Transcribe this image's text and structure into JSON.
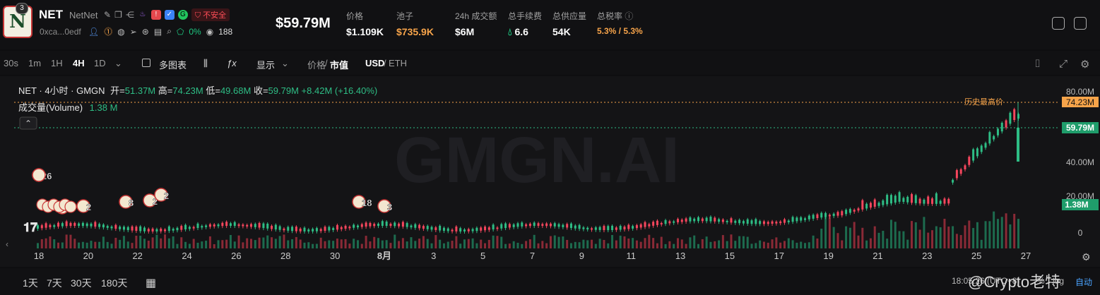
{
  "token": {
    "badge": "3",
    "logo_letter": "N",
    "symbol": "NET",
    "name": "NetNet",
    "unsafe_label": "不安全",
    "address": "0xca...0edf",
    "holders_change": "0%",
    "watchers": "188"
  },
  "market": {
    "market_cap": "$59.79M",
    "stats": [
      {
        "label": "价格",
        "value": "$1.109K"
      },
      {
        "label": "池子",
        "value": "$735.9K"
      },
      {
        "label": "24h 成交额",
        "value": "$6M"
      },
      {
        "label": "总手续费",
        "value": "6.6"
      },
      {
        "label": "总供应量",
        "value": "54K"
      },
      {
        "label": "总税率",
        "value": "5.3% / 5.3%"
      }
    ]
  },
  "toolbar": {
    "intervals": [
      "30s",
      "1m",
      "1H",
      "4H",
      "1D"
    ],
    "active_interval": "4H",
    "multi_chart": "多图表",
    "display": "显示",
    "price_label": "价格",
    "mcap_label": "市值",
    "usd_label": "USD",
    "eth_label": "ETH"
  },
  "chart": {
    "legend_title": "NET · 4小时 · GMGN",
    "open_label": "开=",
    "open_value": "51.37M",
    "high_label": "高=",
    "high_value": "74.23M",
    "low_label": "低=",
    "low_value": "49.68M",
    "close_label": "收=",
    "close_value": "59.79M",
    "change": "+8.42M (+16.40%)",
    "volume_label": "成交量(Volume)",
    "volume_value": "1.38 M",
    "watermark": "GMGN.AI",
    "ath_label": "历史最高价",
    "ath_tag": "74.23M",
    "last_tag": "59.79M",
    "volume_tag": "1.38M",
    "y_ticks": [
      "80.00M",
      "40.00M",
      "20.00M",
      "0"
    ],
    "x_ticks": [
      "18",
      "20",
      "22",
      "24",
      "26",
      "28",
      "30",
      "8月",
      "3",
      "5",
      "7",
      "9",
      "11",
      "13",
      "15",
      "17",
      "19",
      "21",
      "23",
      "25",
      "27"
    ],
    "trade_markers": [
      "26",
      "5",
      "2",
      "8",
      "2",
      "2",
      "18",
      "3"
    ],
    "colors": {
      "up": "#2ebd85",
      "down": "#f6465d",
      "ath": "#f7a44a"
    }
  },
  "bottom": {
    "ranges": [
      "1天",
      "7天",
      "30天",
      "180天"
    ],
    "time": "18:05:26 (UTC+8)",
    "pct": "%",
    "log": "log",
    "auto": "自动",
    "watermark_text": "@Crypto老特"
  }
}
